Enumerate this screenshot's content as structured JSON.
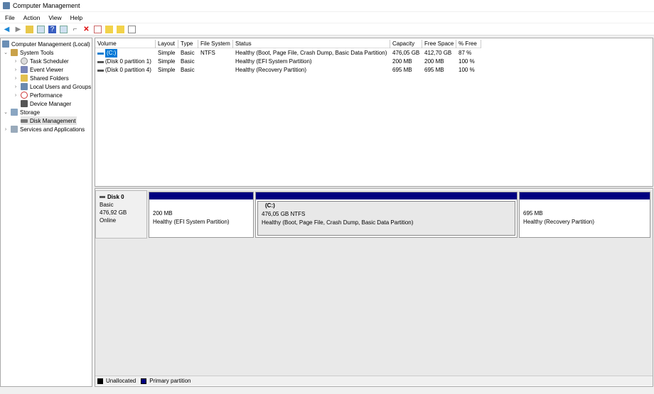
{
  "window": {
    "title": "Computer Management"
  },
  "menu": [
    "File",
    "Action",
    "View",
    "Help"
  ],
  "toolbar": [
    "back-icon",
    "forward-icon",
    "up-icon",
    "show-hide-tree-icon",
    "help-icon",
    "view-icon",
    "connect-icon",
    "delete-icon",
    "properties-icon",
    "new-icon",
    "search-icon",
    "list-icon"
  ],
  "tree": {
    "root": "Computer Management (Local)",
    "system_tools": "System Tools",
    "task_scheduler": "Task Scheduler",
    "event_viewer": "Event Viewer",
    "shared_folders": "Shared Folders",
    "local_users": "Local Users and Groups",
    "performance": "Performance",
    "device_manager": "Device Manager",
    "storage": "Storage",
    "disk_management": "Disk Management",
    "services": "Services and Applications"
  },
  "table": {
    "columns": [
      "Volume",
      "Layout",
      "Type",
      "File System",
      "Status",
      "Capacity",
      "Free Space",
      "% Free"
    ],
    "rows": [
      [
        "(C:)",
        "Simple",
        "Basic",
        "NTFS",
        "Healthy (Boot, Page File, Crash Dump, Basic Data Partition)",
        "476,05 GB",
        "412,70 GB",
        "87 %"
      ],
      [
        "(Disk 0 partition 1)",
        "Simple",
        "Basic",
        "",
        "Healthy (EFI System Partition)",
        "200 MB",
        "200 MB",
        "100 %"
      ],
      [
        "(Disk 0 partition 4)",
        "Simple",
        "Basic",
        "",
        "Healthy (Recovery Partition)",
        "695 MB",
        "695 MB",
        "100 %"
      ]
    ]
  },
  "disk": {
    "name": "Disk 0",
    "type": "Basic",
    "size": "476,92 GB",
    "state": "Online",
    "partitions": [
      {
        "name": "",
        "size": "200 MB",
        "status": "Healthy (EFI System Partition)"
      },
      {
        "name": "(C:)",
        "size": "476,05 GB NTFS",
        "status": "Healthy (Boot, Page File, Crash Dump, Basic Data Partition)"
      },
      {
        "name": "",
        "size": "695 MB",
        "status": "Healthy (Recovery Partition)"
      }
    ]
  },
  "legend": {
    "unallocated": "Unallocated",
    "primary": "Primary partition"
  },
  "colors": {
    "primary": "#000080",
    "unallocated": "#000000",
    "selection": "#0078d7"
  }
}
